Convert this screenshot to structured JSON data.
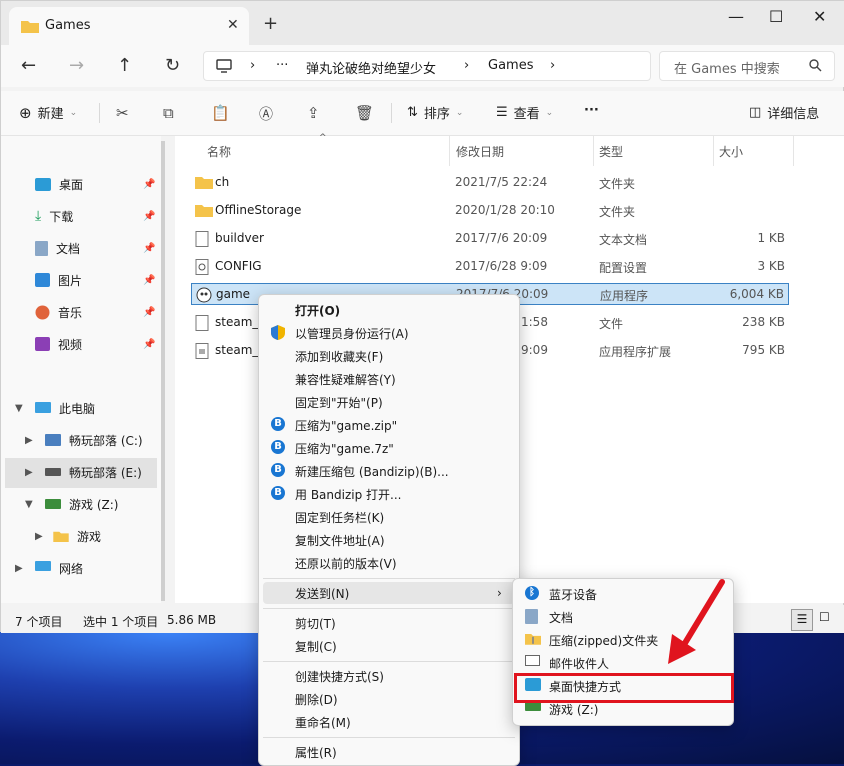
{
  "tab": {
    "title": "Games"
  },
  "address": {
    "crumbs": [
      "弹丸论破绝对绝望少女",
      "Games"
    ],
    "ellipsis": "···"
  },
  "search": {
    "placeholder": "在 Games 中搜索"
  },
  "toolbar": {
    "new": "新建",
    "sort": "排序",
    "view": "查看",
    "more": "···",
    "details": "详细信息"
  },
  "sidebar": {
    "quick": [
      {
        "label": "桌面"
      },
      {
        "label": "下载"
      },
      {
        "label": "文档"
      },
      {
        "label": "图片"
      },
      {
        "label": "音乐"
      },
      {
        "label": "视频"
      }
    ],
    "this_pc": "此电脑",
    "drives": [
      {
        "label": "畅玩部落 (C:)"
      },
      {
        "label": "畅玩部落 (E:)"
      },
      {
        "label": "游戏 (Z:)"
      }
    ],
    "sub": "游戏",
    "network": "网络"
  },
  "columns": {
    "name": "名称",
    "date": "修改日期",
    "type": "类型",
    "size": "大小"
  },
  "files": [
    {
      "name": "ch",
      "date": "2021/7/5 22:24",
      "type": "文件夹",
      "size": ""
    },
    {
      "name": "OfflineStorage",
      "date": "2020/1/28 20:10",
      "type": "文件夹",
      "size": ""
    },
    {
      "name": "buildver",
      "date": "2017/7/6 20:09",
      "type": "文本文档",
      "size": "1 KB"
    },
    {
      "name": "CONFIG",
      "date": "2017/6/28 9:09",
      "type": "配置设置",
      "size": "3 KB"
    },
    {
      "name": "game",
      "date": "2017/7/6 20:09",
      "type": "应用程序",
      "size": "6,004 KB"
    },
    {
      "name": "steam_a",
      "date": "1:58",
      "type": "文件",
      "size": "238 KB"
    },
    {
      "name": "steam_a",
      "date": "9:09",
      "type": "应用程序扩展",
      "size": "795 KB"
    }
  ],
  "status": {
    "count": "7 个项目",
    "selected": "选中 1 个项目",
    "size": "5.86 MB"
  },
  "context_menu": {
    "items": [
      "打开(O)",
      "以管理员身份运行(A)",
      "添加到收藏夹(F)",
      "兼容性疑难解答(Y)",
      "固定到\"开始\"(P)",
      "压缩为\"game.zip\"",
      "压缩为\"game.7z\"",
      "新建压缩包 (Bandizip)(B)...",
      "用 Bandizip 打开...",
      "固定到任务栏(K)",
      "复制文件地址(A)",
      "还原以前的版本(V)"
    ],
    "send_to": "发送到(N)",
    "items2": [
      "剪切(T)",
      "复制(C)"
    ],
    "items3": [
      "创建快捷方式(S)",
      "删除(D)",
      "重命名(M)"
    ],
    "properties": "属性(R)"
  },
  "send_to_menu": {
    "items": [
      "蓝牙设备",
      "文档",
      "压缩(zipped)文件夹",
      "邮件收件人",
      "桌面快捷方式",
      "游戏 (Z:)"
    ]
  },
  "colors": {
    "accent": "#0067c0",
    "highlight_box": "#e0141e"
  }
}
